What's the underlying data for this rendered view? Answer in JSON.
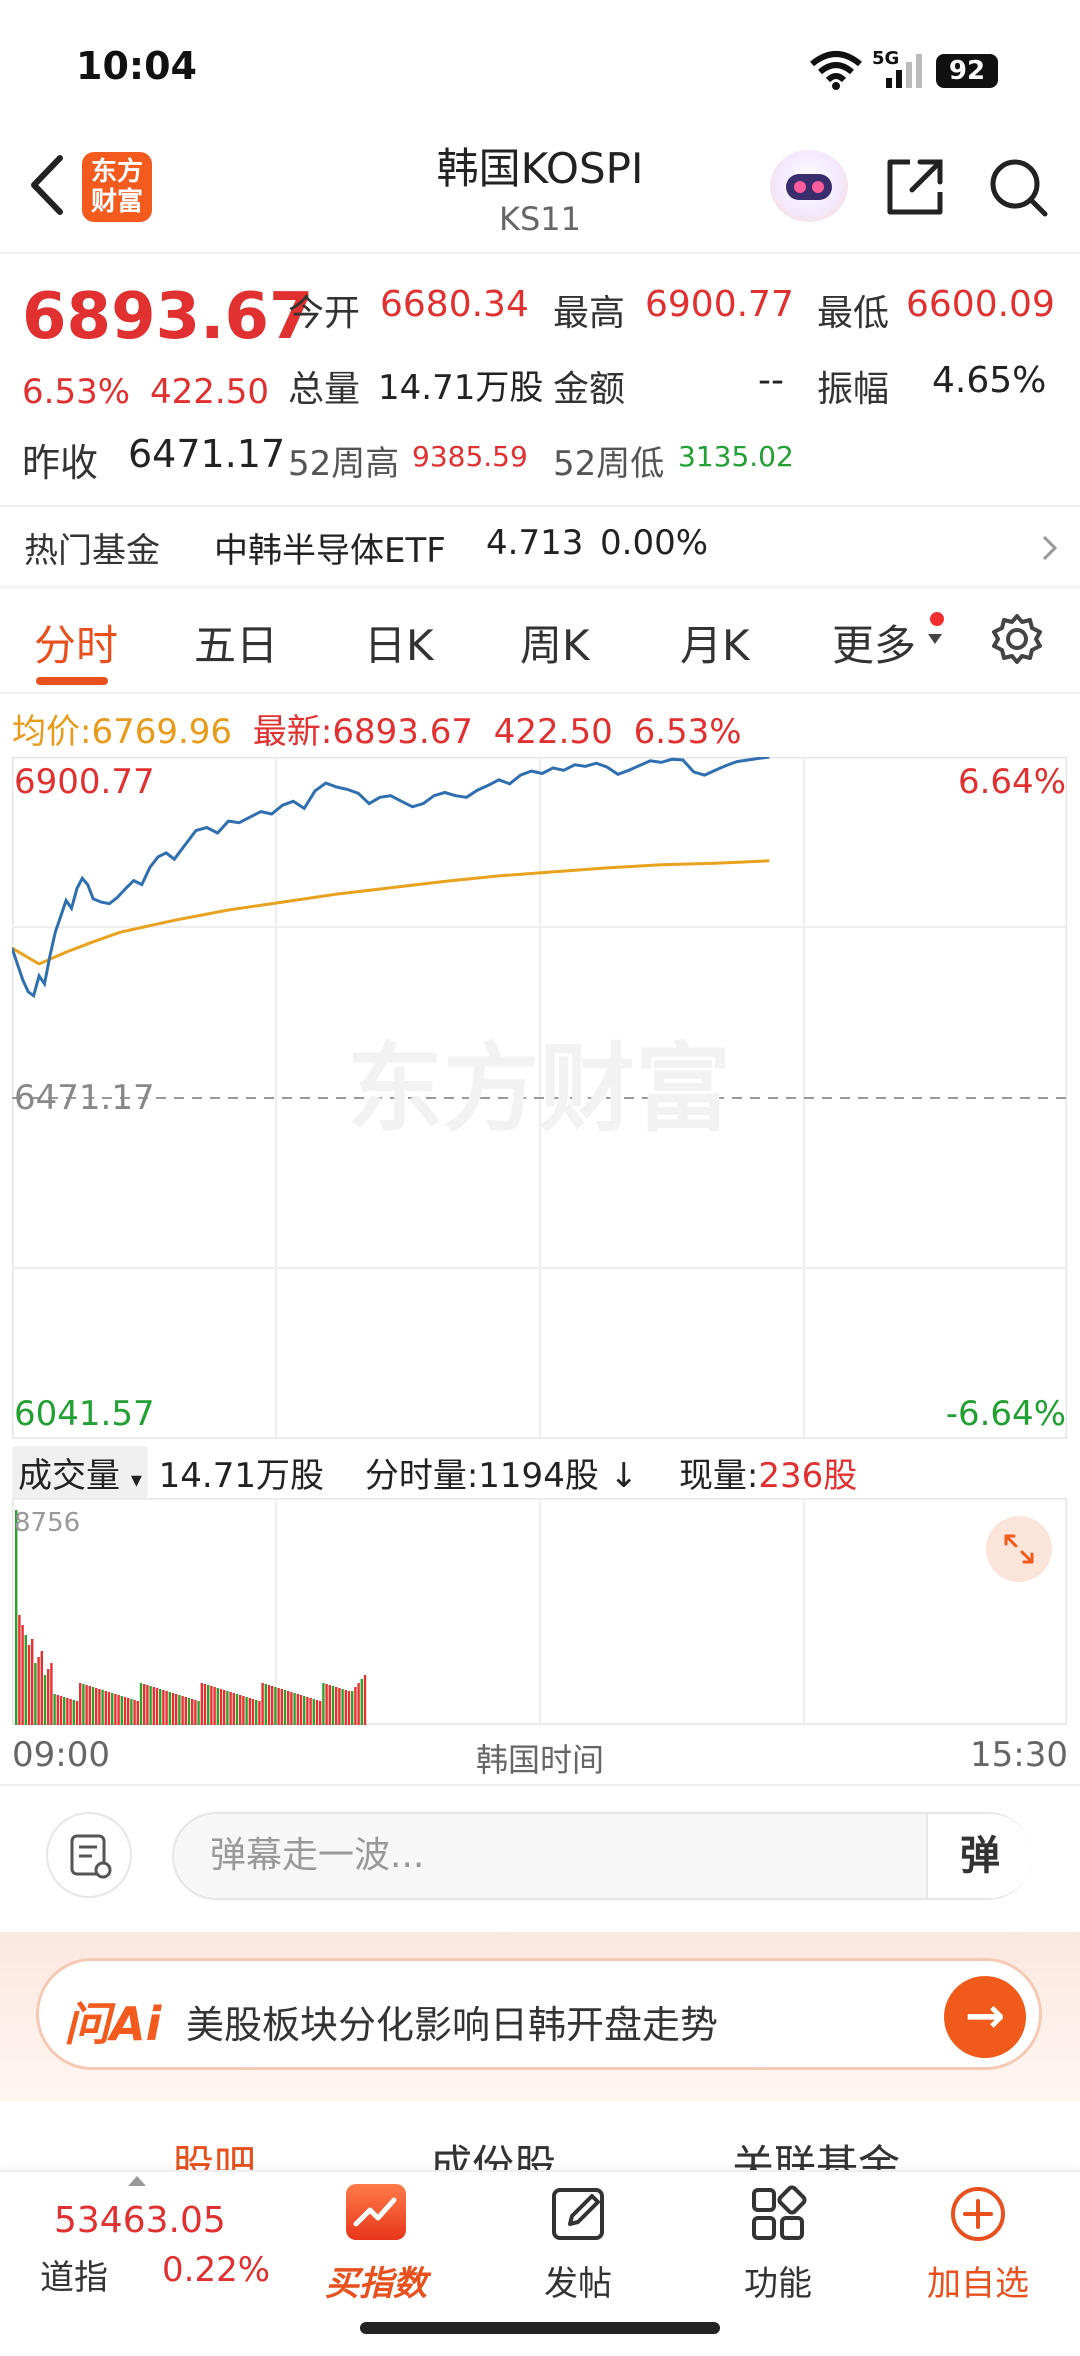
{
  "status_bar": {
    "time": "10:04",
    "network": "5G",
    "battery": "92"
  },
  "header": {
    "logo_line1": "东方",
    "logo_line2": "财富",
    "title": "韩国KOSPI",
    "subtitle": "KS11"
  },
  "quote": {
    "price": "6893.67",
    "change_pct": "6.53%",
    "change_abs": "422.50",
    "open_label": "今开",
    "open_value": "6680.34",
    "high_label": "最高",
    "high_value": "6900.77",
    "low_label": "最低",
    "low_value": "6600.09",
    "volume_label": "总量",
    "volume_value": "14.71万股",
    "amount_label": "金额",
    "amount_value": "--",
    "amplitude_label": "振幅",
    "amplitude_value": "4.65%",
    "prev_close_label": "昨收",
    "prev_close_value": "6471.17",
    "wk52_high_label": "52周高",
    "wk52_high_value": "9385.59",
    "wk52_low_label": "52周低",
    "wk52_low_value": "3135.02"
  },
  "hot_fund": {
    "label": "热门基金",
    "name": "中韩半导体ETF",
    "price": "4.713",
    "change": "0.00%"
  },
  "tabs": [
    {
      "label": "分时"
    },
    {
      "label": "五日"
    },
    {
      "label": "日K"
    },
    {
      "label": "周K"
    },
    {
      "label": "月K"
    },
    {
      "label": "更多"
    }
  ],
  "avg_row": {
    "avg_label": "均价:",
    "avg_value": "6769.96",
    "latest_label": "最新:",
    "latest_value": "6893.67",
    "latest_change": "422.50",
    "latest_pct": "6.53%"
  },
  "chart_labels": {
    "top_price": "6900.77",
    "top_pct": "6.64%",
    "mid_price": "6471.17",
    "bottom_price": "6041.57",
    "bottom_pct": "-6.64%",
    "watermark": "东方财富"
  },
  "volume_row": {
    "selector": "成交量",
    "total": "14.71万股",
    "minute_label": "分时量:",
    "minute_value": "1194股",
    "current_label": "现量:",
    "current_value": "236股",
    "max_label": "8756"
  },
  "time_axis": {
    "start": "09:00",
    "middle": "韩国时间",
    "end": "15:30"
  },
  "danmu": {
    "placeholder": "弹幕走一波...",
    "button": "弹"
  },
  "ai_banner": {
    "logo": "问Ai",
    "text": "美股板块分化影响日韩开盘走势",
    "arrow": "→"
  },
  "lower_tabs": [
    {
      "label": "股吧"
    },
    {
      "label": "成份股"
    },
    {
      "label": "关联基金"
    }
  ],
  "bottom_nav": {
    "index_value": "53463.05",
    "index_name": "道指",
    "index_pct": "0.22%",
    "buy_label": "买指数",
    "post_label": "发帖",
    "function_label": "功能",
    "add_label": "加自选"
  },
  "chart_data": {
    "type": "line",
    "x_range": [
      "09:00",
      "15:30"
    ],
    "y_range": [
      6041.57,
      6900.77
    ],
    "baseline": 6471.17,
    "series": [
      {
        "name": "最新",
        "x_minutes": [
          0,
          2,
          4,
          6,
          8,
          10,
          12,
          14,
          16,
          18,
          20,
          22,
          24,
          26,
          28,
          30,
          33,
          36,
          39,
          42,
          45,
          48,
          51,
          54,
          57,
          60,
          64,
          68,
          72,
          76,
          80,
          84,
          88,
          92,
          96,
          100,
          104,
          108,
          112,
          116,
          120,
          124,
          128,
          132,
          136,
          140,
          144,
          148,
          152,
          156,
          160,
          164,
          168,
          172,
          176,
          180,
          184,
          188,
          192,
          196,
          200,
          204,
          208,
          212,
          216,
          220,
          224,
          228,
          232,
          236,
          240,
          244,
          248,
          252,
          256,
          260,
          264,
          268,
          272,
          276,
          280
        ],
        "values": [
          6660,
          6640,
          6620,
          6605,
          6600,
          6625,
          6615,
          6650,
          6680,
          6700,
          6720,
          6710,
          6735,
          6748,
          6740,
          6722,
          6718,
          6716,
          6724,
          6735,
          6745,
          6740,
          6762,
          6775,
          6780,
          6772,
          6790,
          6808,
          6812,
          6805,
          6820,
          6818,
          6825,
          6832,
          6829,
          6840,
          6845,
          6836,
          6858,
          6868,
          6863,
          6860,
          6855,
          6842,
          6850,
          6852,
          6845,
          6838,
          6842,
          6852,
          6856,
          6852,
          6850,
          6859,
          6865,
          6872,
          6867,
          6878,
          6883,
          6880,
          6887,
          6884,
          6891,
          6889,
          6893,
          6888,
          6879,
          6884,
          6890,
          6896,
          6894,
          6898,
          6897,
          6882,
          6878,
          6884,
          6890,
          6895,
          6897,
          6899,
          6900.77
        ]
      },
      {
        "name": "均价",
        "x_minutes": [
          0,
          10,
          20,
          30,
          40,
          60,
          80,
          100,
          120,
          140,
          160,
          180,
          200,
          220,
          240,
          260,
          280
        ],
        "values": [
          6660,
          6640,
          6655,
          6668,
          6680,
          6695,
          6708,
          6718,
          6728,
          6736,
          6744,
          6751,
          6756,
          6761,
          6765,
          6767,
          6769.96
        ]
      }
    ]
  }
}
